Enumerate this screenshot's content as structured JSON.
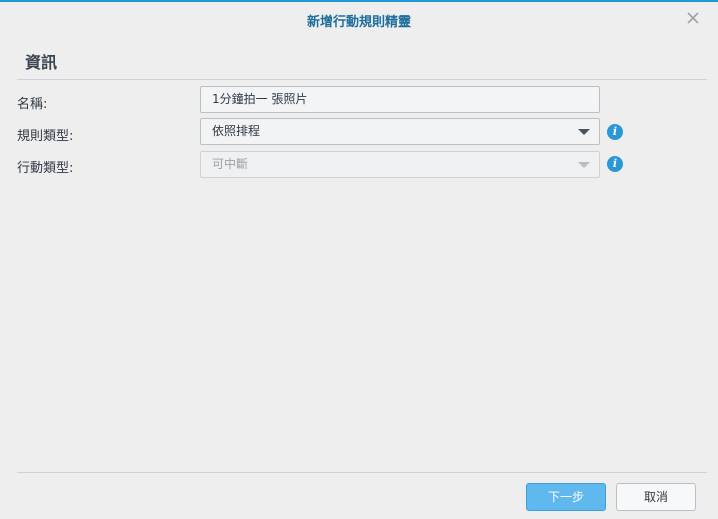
{
  "window": {
    "title": "新增行動規則精靈"
  },
  "section": {
    "title": "資訊"
  },
  "form": {
    "name_label": "名稱:",
    "name_value": "1分鐘拍一 張照片",
    "rule_type_label": "規則類型:",
    "rule_type_value": "依照排程",
    "action_type_label": "行動類型:",
    "action_type_value": "可中斷"
  },
  "footer": {
    "next_label": "下一步",
    "cancel_label": "取消"
  },
  "colors": {
    "accent": "#1f9ad6",
    "primary_button": "#5fb8ee",
    "info_icon": "#2a97d6"
  },
  "icons": {
    "close": "close-icon",
    "info": "info-icon",
    "dropdown": "chevron-down-icon"
  }
}
